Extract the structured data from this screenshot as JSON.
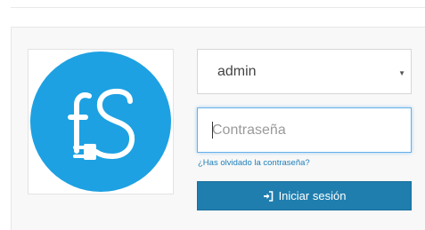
{
  "login": {
    "user_selected": "admin",
    "password_placeholder": "Contraseña",
    "forgot_password_label": "¿Has olvidado la contraseña?",
    "submit_label": "Iniciar sesión"
  },
  "logo": {
    "text": "fS",
    "icon": "plug-icon"
  },
  "colors": {
    "logo_blue": "#1da1e2",
    "button_blue": "#1f7eae",
    "focus_border": "#66afe9",
    "link": "#1e7fb8"
  }
}
